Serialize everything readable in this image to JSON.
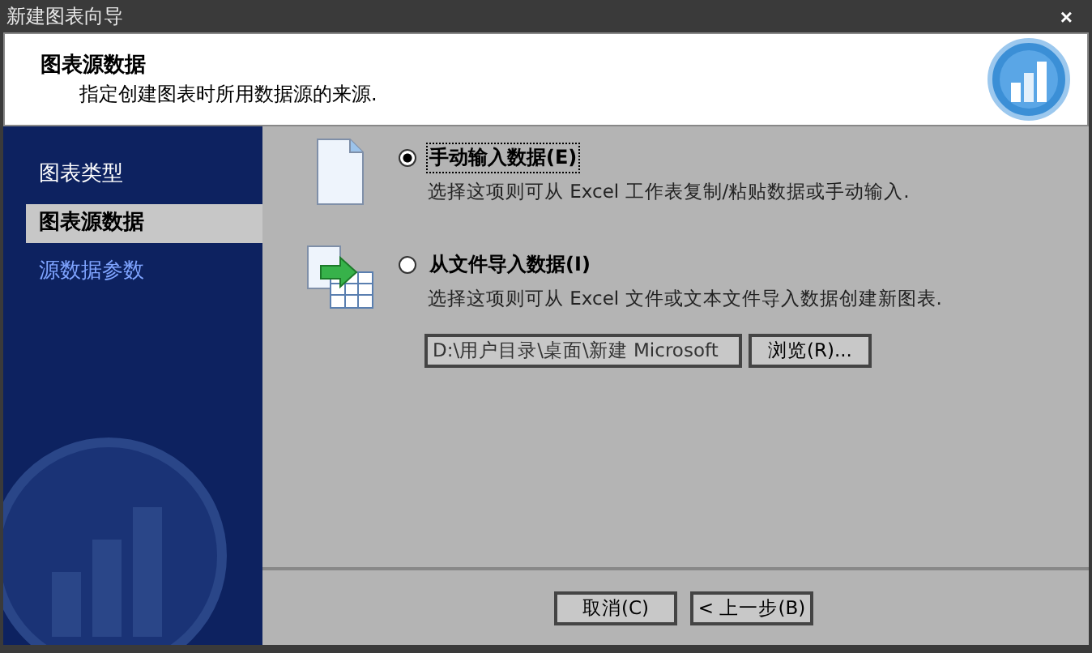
{
  "window": {
    "title": "新建图表向导",
    "close": "×"
  },
  "header": {
    "title": "图表源数据",
    "subtitle": "指定创建图表时所用数据源的来源."
  },
  "steps": [
    {
      "label": "图表类型",
      "selected": false,
      "disabled": false
    },
    {
      "label": "图表源数据",
      "selected": true,
      "disabled": false
    },
    {
      "label": "源数据参数",
      "selected": false,
      "disabled": true
    }
  ],
  "options": [
    {
      "kind": "manual",
      "label": "手动输入数据(E)",
      "description": "选择这项则可从 Excel 工作表复制/粘贴数据或手动输入.",
      "selected": true,
      "focused": true
    },
    {
      "kind": "file",
      "label": "从文件导入数据(I)",
      "description": "选择这项则可从 Excel 文件或文本文件导入数据创建新图表.",
      "selected": false,
      "focused": false
    }
  ],
  "file_import": {
    "path": "D:\\用户目录\\桌面\\新建 Microsoft",
    "browse_button": "浏览(R)..."
  },
  "buttons": [
    "取消(C)",
    "< 上一步(B)"
  ]
}
